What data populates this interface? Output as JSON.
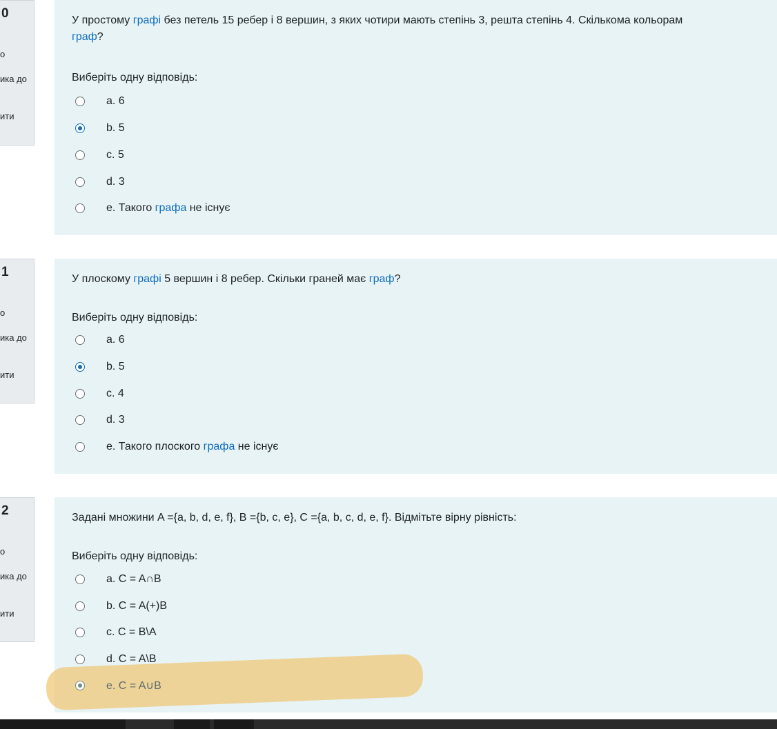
{
  "questions": [
    {
      "number_fragment": "0",
      "info_fragments": [
        "о",
        "ика до",
        "ити"
      ],
      "text_parts": [
        {
          "t": "У простому ",
          "link": false
        },
        {
          "t": "графі",
          "link": true
        },
        {
          "t": " без петель 15 ребер і 8 вершин, з яких чотири мають степінь 3, решта степінь 4. Скількома кольорам",
          "link": false
        },
        {
          "t": "граф",
          "link": true
        },
        {
          "t": "?",
          "link": false
        }
      ],
      "prompt": "Виберіть одну відповідь:",
      "options": [
        {
          "letter": "a.",
          "parts": [
            {
              "t": "6",
              "link": false
            }
          ],
          "checked": false
        },
        {
          "letter": "b.",
          "parts": [
            {
              "t": "5",
              "link": false
            }
          ],
          "checked": true
        },
        {
          "letter": "c.",
          "parts": [
            {
              "t": "5",
              "link": false
            }
          ],
          "checked": false
        },
        {
          "letter": "d.",
          "parts": [
            {
              "t": "3",
              "link": false
            }
          ],
          "checked": false
        },
        {
          "letter": "e.",
          "parts": [
            {
              "t": "Такого ",
              "link": false
            },
            {
              "t": "графа",
              "link": true
            },
            {
              "t": " не існує",
              "link": false
            }
          ],
          "checked": false
        }
      ]
    },
    {
      "number_fragment": "1",
      "info_fragments": [
        "о",
        "ика до",
        "ити"
      ],
      "text_parts": [
        {
          "t": "У плоскому ",
          "link": false
        },
        {
          "t": "графі",
          "link": true
        },
        {
          "t": " 5 вершин і 8 ребер. Скільки граней має ",
          "link": false
        },
        {
          "t": "граф",
          "link": true
        },
        {
          "t": "?",
          "link": false
        }
      ],
      "prompt": "Виберіть одну відповідь:",
      "options": [
        {
          "letter": "a.",
          "parts": [
            {
              "t": "6",
              "link": false
            }
          ],
          "checked": false
        },
        {
          "letter": "b.",
          "parts": [
            {
              "t": "5",
              "link": false
            }
          ],
          "checked": true
        },
        {
          "letter": "c.",
          "parts": [
            {
              "t": "4",
              "link": false
            }
          ],
          "checked": false
        },
        {
          "letter": "d.",
          "parts": [
            {
              "t": "3",
              "link": false
            }
          ],
          "checked": false
        },
        {
          "letter": "e.",
          "parts": [
            {
              "t": "Такого плоского ",
              "link": false
            },
            {
              "t": "графа",
              "link": true
            },
            {
              "t": " не існує",
              "link": false
            }
          ],
          "checked": false
        }
      ]
    },
    {
      "number_fragment": "2",
      "info_fragments": [
        "о",
        "ика до",
        "ити"
      ],
      "text_parts": [
        {
          "t": "Задані множини A ={a, b, d, e, f}, B ={b, c, e}, C ={a, b, c, d, e, f}. Відмітьте вірну рівність:",
          "link": false
        }
      ],
      "prompt": "Виберіть одну відповідь:",
      "options": [
        {
          "letter": "a.",
          "parts": [
            {
              "t": "C = A∩B",
              "link": false
            }
          ],
          "checked": false
        },
        {
          "letter": "b.",
          "parts": [
            {
              "t": "C = A(+)B",
              "link": false
            }
          ],
          "checked": false
        },
        {
          "letter": "c.",
          "parts": [
            {
              "t": "C = B\\A",
              "link": false
            }
          ],
          "checked": false
        },
        {
          "letter": "d.",
          "parts": [
            {
              "t": "C = A\\B",
              "link": false
            }
          ],
          "checked": false
        },
        {
          "letter": "e.",
          "parts": [
            {
              "t": "C = A∪B",
              "link": false
            }
          ],
          "checked": true
        }
      ]
    }
  ],
  "colors": {
    "link": "#0f6cbf",
    "panel_bg": "#e7f3f5",
    "info_bg": "#e9ecef",
    "highlight": "#f0c878"
  }
}
